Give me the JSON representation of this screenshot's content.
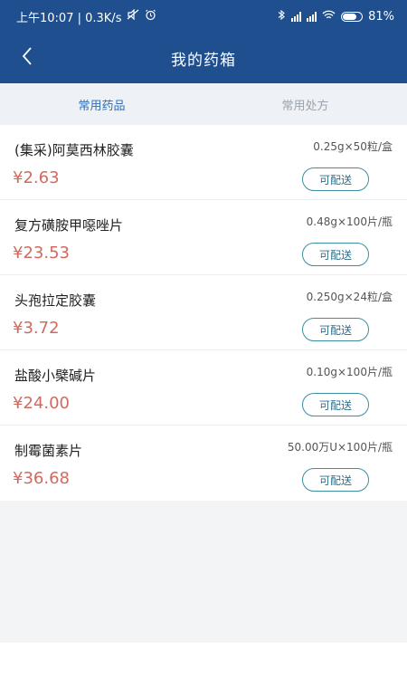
{
  "status": {
    "left": "上午10:07 | 0.3K/s",
    "battery": "81%"
  },
  "header": {
    "title": "我的药箱"
  },
  "tabs": [
    {
      "label": "常用药品",
      "active": true
    },
    {
      "label": "常用处方",
      "active": false
    }
  ],
  "items": [
    {
      "name": "(集采)阿莫西林胶囊",
      "price": "¥2.63",
      "spec": "0.25g×50粒/盒",
      "button": "可配送"
    },
    {
      "name": "复方磺胺甲噁唑片",
      "price": "¥23.53",
      "spec": "0.48g×100片/瓶",
      "button": "可配送"
    },
    {
      "name": "头孢拉定胶囊",
      "price": "¥3.72",
      "spec": "0.250g×24粒/盒",
      "button": "可配送"
    },
    {
      "name": "盐酸小檗碱片",
      "price": "¥24.00",
      "spec": "0.10g×100片/瓶",
      "button": "可配送"
    },
    {
      "name": "制霉菌素片",
      "price": "¥36.68",
      "spec": "50.00万U×100片/瓶",
      "button": "可配送"
    }
  ],
  "colors": {
    "header_bg": "#1f4f8f",
    "tab_active": "#2f6fb5",
    "price": "#d16a5e",
    "button_border": "#3c8fa0"
  },
  "icons": [
    "back-arrow-icon",
    "mute-icon",
    "alarm-icon",
    "bluetooth-icon",
    "signal-icon",
    "wifi-icon",
    "battery-icon"
  ]
}
